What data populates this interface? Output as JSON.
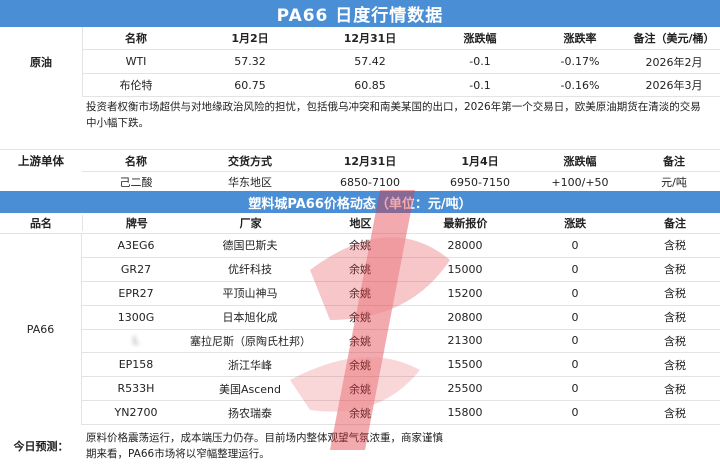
{
  "title": "PA66 日度行情数据",
  "crude": {
    "label": "原油",
    "headers": [
      "名称",
      "1月2日",
      "12月31日",
      "涨跌幅",
      "涨跌率",
      "备注（美元/桶）"
    ],
    "rows": [
      [
        "WTI",
        "57.32",
        "57.42",
        "-0.1",
        "-0.17%",
        "2026年2月"
      ],
      [
        "布伦特",
        "60.75",
        "60.85",
        "-0.1",
        "-0.16%",
        "2026年3月"
      ]
    ],
    "note": "投资者权衡市场超供与对地缘政治风险的担忧，包括俄乌冲突和南美某国的出口，2026年第一个交易日，欧美原油期货在清淡的交易中小幅下跌。"
  },
  "upstream": {
    "label": "上游单体",
    "headers": [
      "名称",
      "交货方式",
      "12月31日",
      "1月4日",
      "涨跌幅",
      "备注"
    ],
    "row": [
      "己二酸",
      "华东地区",
      "6850-7100",
      "6950-7150",
      "+100/+50",
      "元/吨"
    ]
  },
  "pa66": {
    "bar_title": "塑料城PA66价格动态（单位：元/吨）",
    "headers": [
      "品名",
      "牌号",
      "厂家",
      "地区",
      "最新报价",
      "涨跌",
      "备注"
    ],
    "product": "PA66",
    "rows": [
      [
        "A3EG6",
        "德国巴斯夫",
        "余姚",
        "28000",
        "0",
        "含税"
      ],
      [
        "GR27",
        "优纤科技",
        "余姚",
        "15000",
        "0",
        "含税"
      ],
      [
        "EPR27",
        "平顶山神马",
        "余姚",
        "15200",
        "0",
        "含税"
      ],
      [
        "1300G",
        "日本旭化成",
        "余姚",
        "20800",
        "0",
        "含税"
      ],
      [
        "L",
        "塞拉尼斯（原陶氏杜邦）",
        "余姚",
        "21300",
        "0",
        "含税"
      ],
      [
        "EP158",
        "浙江华峰",
        "余姚",
        "15500",
        "0",
        "含税"
      ],
      [
        "R533H",
        "美国Ascend",
        "余姚",
        "25500",
        "0",
        "含税"
      ],
      [
        "YN2700",
        "扬农瑞泰",
        "余姚",
        "15800",
        "0",
        "含税"
      ]
    ]
  },
  "forecast": {
    "label": "今日预测：",
    "text": "原料价格震荡运行，成本端压力仍存。目前场内整体观望气氛浓重，商家谨慎期来看，PA66市场将以窄幅整理运行。"
  },
  "colors": {
    "header_blue": "#4a8fd6",
    "watermark_red": "#e0303a"
  }
}
